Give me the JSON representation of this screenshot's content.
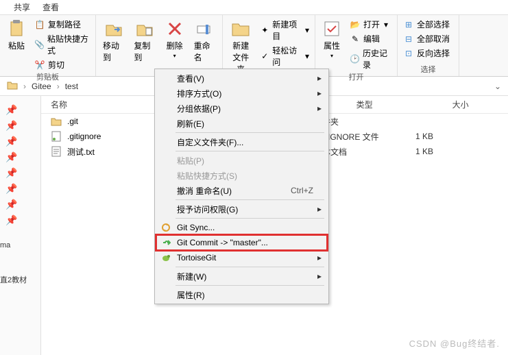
{
  "tabs": {
    "share": "共享",
    "view": "查看"
  },
  "ribbon": {
    "clipboard": {
      "copypath": "复制路径",
      "pasteshortcut": "粘贴快捷方式",
      "paste": "粘贴",
      "cut": "剪切",
      "label": "剪贴板"
    },
    "organize": {
      "moveto": "移动到",
      "copyto": "复制到",
      "delete": "删除",
      "rename": "重命名"
    },
    "new": {
      "newfolder": "新建\n文件夹",
      "newitem": "新建项目",
      "easyaccess": "轻松访问"
    },
    "open": {
      "props": "属性",
      "open": "打开",
      "edit": "编辑",
      "history": "历史记录",
      "label": "打开"
    },
    "select": {
      "all": "全部选择",
      "none": "全部取消",
      "invert": "反向选择",
      "label": "选择"
    }
  },
  "breadcrumb": {
    "p1": "Gitee",
    "p2": "test"
  },
  "columns": {
    "name": "名称",
    "type": "类型",
    "size": "大小"
  },
  "files": [
    {
      "name": ".git",
      "type": "文件夹",
      "size": ""
    },
    {
      "name": ".gitignore",
      "type": "GITIGNORE 文件",
      "size": "1 KB"
    },
    {
      "name": "测试.txt",
      "type": "文本文档",
      "size": "1 KB"
    }
  ],
  "sidebar": {
    "tag1": "ma",
    "tag2": "直2教材"
  },
  "menu": {
    "view": "查看(V)",
    "sort": "排序方式(O)",
    "group": "分组依据(P)",
    "refresh": "刷新(E)",
    "custom": "自定义文件夹(F)...",
    "paste": "粘贴(P)",
    "pastesc": "粘贴快捷方式(S)",
    "undo": "撤消 重命名(U)",
    "undo_sc": "Ctrl+Z",
    "access": "授予访问权限(G)",
    "sync": "Git Sync...",
    "commit": "Git Commit -> \"master\"...",
    "tortoise": "TortoiseGit",
    "new": "新建(W)",
    "props": "属性(R)"
  },
  "watermark": "CSDN @Bug终结者."
}
